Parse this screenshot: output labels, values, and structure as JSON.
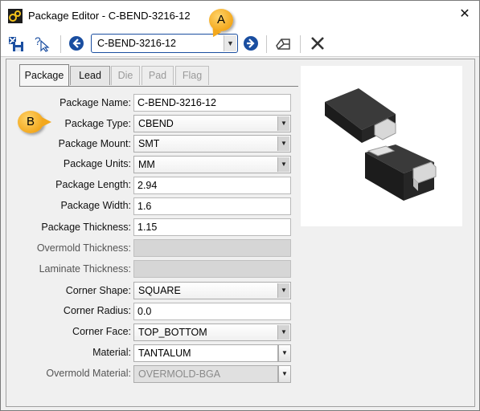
{
  "window": {
    "title": "Package Editor - C-BEND-3216-12",
    "close_glyph": "✕"
  },
  "toolbar": {
    "package_select_value": "C-BEND-3216-12",
    "icons": [
      "save-close-icon",
      "help-cursor-icon",
      "previous-arrow-icon",
      "next-arrow-icon",
      "3d-view-icon",
      "delete-icon"
    ]
  },
  "callouts": {
    "a": "A",
    "b": "B"
  },
  "tabs": [
    {
      "label": "Package",
      "state": "active"
    },
    {
      "label": "Lead",
      "state": "normal"
    },
    {
      "label": "Die",
      "state": "disabled"
    },
    {
      "label": "Pad",
      "state": "disabled"
    },
    {
      "label": "Flag",
      "state": "disabled"
    }
  ],
  "form": {
    "package_name": {
      "label": "Package Name:",
      "value": "C-BEND-3216-12"
    },
    "package_type": {
      "label": "Package Type:",
      "value": "CBEND"
    },
    "package_mount": {
      "label": "Package Mount:",
      "value": "SMT"
    },
    "package_units": {
      "label": "Package Units:",
      "value": "MM"
    },
    "package_length": {
      "label": "Package Length:",
      "value": "2.94"
    },
    "package_width": {
      "label": "Package Width:",
      "value": "1.6"
    },
    "package_thickness": {
      "label": "Package Thickness:",
      "value": "1.15"
    },
    "overmold_thickness": {
      "label": "Overmold Thickness:",
      "value": ""
    },
    "laminate_thickness": {
      "label": "Laminate Thickness:",
      "value": ""
    },
    "corner_shape": {
      "label": "Corner Shape:",
      "value": "SQUARE"
    },
    "corner_radius": {
      "label": "Corner Radius:",
      "value": "0.0"
    },
    "corner_face": {
      "label": "Corner Face:",
      "value": "TOP_BOTTOM"
    },
    "material": {
      "label": "Material:",
      "value": "TANTALUM"
    },
    "overmold_material": {
      "label": "Overmold Material:",
      "value": "OVERMOLD-BGA"
    }
  },
  "colors": {
    "accent_blue": "#1a4ea0",
    "callout_orange": "#f3a81d",
    "component_body": "#2b2b2b",
    "terminal_silver": "#d8d8d8"
  }
}
